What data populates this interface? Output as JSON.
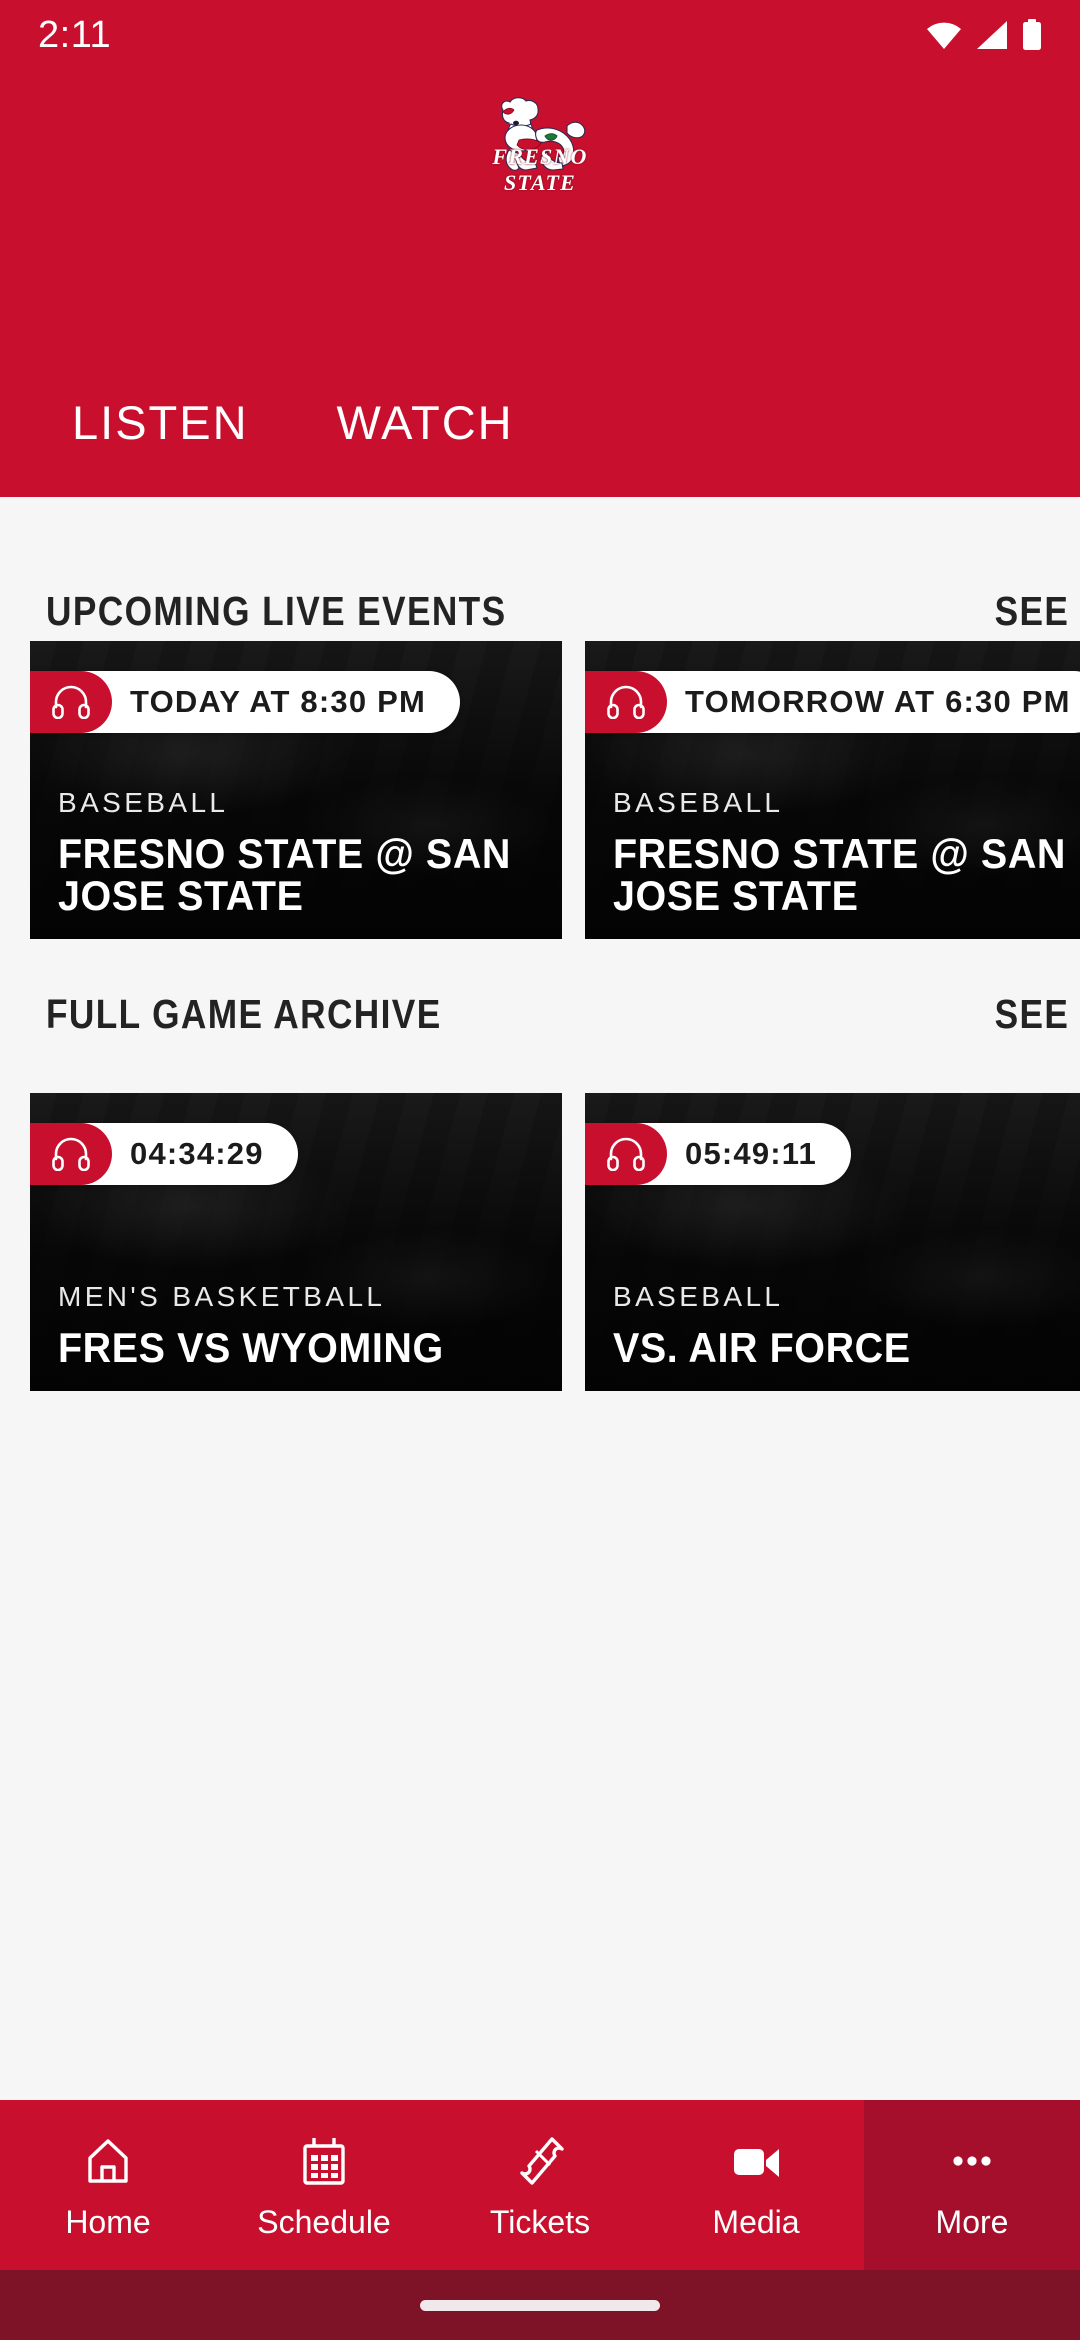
{
  "status_bar": {
    "time": "2:11",
    "icons": [
      "wifi-icon",
      "cellular-signal-icon",
      "battery-icon"
    ]
  },
  "header": {
    "logo_name": "fresno-state-bulldog-logo",
    "logo_text": "FRESNO STATE",
    "background_color": "#C8102E",
    "tabs": [
      {
        "label": "LISTEN",
        "active": true
      },
      {
        "label": "WATCH",
        "active": false
      }
    ]
  },
  "sections": [
    {
      "title": "UPCOMING LIVE EVENTS",
      "see_all_label": "SEE ALL",
      "cards": [
        {
          "badge_icon": "headphones-icon",
          "badge_text": "TODAY AT 8:30 PM",
          "sport": "BASEBALL",
          "title": "FRESNO STATE @ SAN JOSE STATE"
        },
        {
          "badge_icon": "headphones-icon",
          "badge_text": "TOMORROW AT 6:30 PM",
          "sport": "BASEBALL",
          "title": "FRESNO STATE @ SAN JOSE STATE"
        }
      ]
    },
    {
      "title": "FULL GAME ARCHIVE",
      "see_all_label": "SEE ALL",
      "cards": [
        {
          "badge_icon": "headphones-icon",
          "badge_text": "04:34:29",
          "sport": "MEN'S BASKETBALL",
          "title": "FRES VS WYOMING"
        },
        {
          "badge_icon": "headphones-icon",
          "badge_text": "05:49:11",
          "sport": "BASEBALL",
          "title": "VS. AIR FORCE"
        }
      ]
    }
  ],
  "bottom_nav": {
    "background_color": "#C8102E",
    "active_item_color": "#A60F2B",
    "items": [
      {
        "label": "Home",
        "icon": "home-icon"
      },
      {
        "label": "Schedule",
        "icon": "calendar-icon"
      },
      {
        "label": "Tickets",
        "icon": "ticket-icon"
      },
      {
        "label": "Media",
        "icon": "video-camera-icon"
      },
      {
        "label": "More",
        "icon": "ellipsis-icon"
      }
    ]
  }
}
